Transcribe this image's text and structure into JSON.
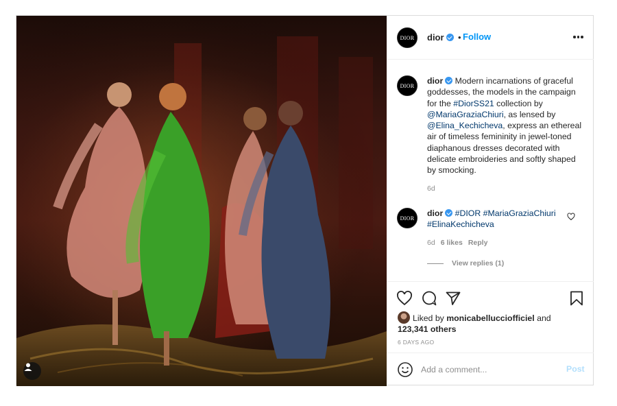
{
  "post": {
    "account": {
      "username": "dior",
      "avatar_text": "DIOR",
      "verified": true,
      "follow_label": "Follow",
      "separator": "•"
    },
    "caption": {
      "username": "dior",
      "parts": [
        "Modern incarnations of graceful goddesses, the models in the campaign for the ",
        "#DiorSS21",
        " collection by ",
        "@MariaGraziaChiuri",
        ", as lensed by ",
        "@Elina_Kechicheva",
        ", express an ethereal air of timeless femininity in jewel-toned diaphanous dresses decorated with delicate embroideries and softly shaped by smocking."
      ],
      "time": "6d"
    },
    "comment": {
      "username": "dior",
      "tags": [
        "#DIOR",
        "#MariaGraziaChiuri",
        "#ElinaKechicheva"
      ],
      "time": "6d",
      "likes": "6 likes",
      "reply_label": "Reply",
      "view_replies": "View replies (1)"
    },
    "likes": {
      "prefix": "Liked by ",
      "user": "monicabellucciofficiel",
      "and": " and ",
      "others": "123,341 others"
    },
    "posted_ago": "6 DAYS AGO",
    "add_comment": {
      "placeholder": "Add a comment...",
      "post_label": "Post"
    },
    "icons": [
      "user-tag-icon",
      "more-options-icon",
      "heart-icon",
      "comment-icon",
      "share-icon",
      "bookmark-icon",
      "emoji-icon",
      "verified-badge-icon"
    ],
    "colors": {
      "link": "#0095f6",
      "hashtag": "#00376b",
      "verified": "#3897f0",
      "muted": "#8e8e8e",
      "post_disabled": "#b2dffc"
    }
  }
}
